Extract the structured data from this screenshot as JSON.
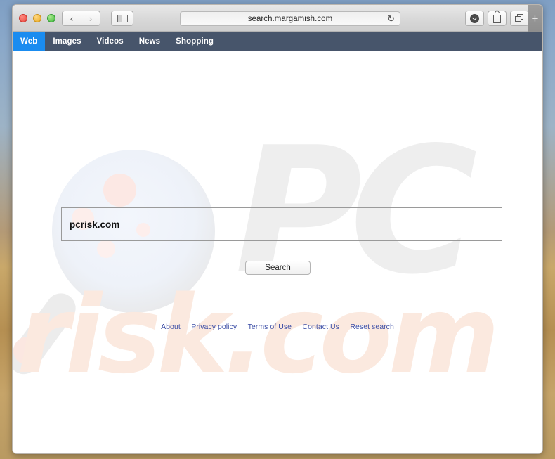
{
  "browser": {
    "window_controls": [
      "close",
      "minimize",
      "maximize"
    ],
    "nav_back_icon": "chevron-left-icon",
    "nav_back_glyph": "‹",
    "nav_forward_icon": "chevron-right-icon",
    "nav_forward_glyph": "›",
    "sidebar_icon": "sidebar-toggle-icon",
    "url": "search.margamish.com",
    "reload_glyph": "↻",
    "reload_icon": "reload-icon",
    "downloads_icon": "downloads-icon",
    "share_icon": "share-icon",
    "tabs_icon": "show-tabs-icon",
    "new_tab_label": "+"
  },
  "sitenav": {
    "items": [
      {
        "label": "Web",
        "active": true
      },
      {
        "label": "Images",
        "active": false
      },
      {
        "label": "Videos",
        "active": false
      },
      {
        "label": "News",
        "active": false
      },
      {
        "label": "Shopping",
        "active": false
      }
    ],
    "bar_color": "#47556b",
    "active_color": "#1a8cf0"
  },
  "search": {
    "value": "pcrisk.com",
    "placeholder": "",
    "button_label": "Search"
  },
  "footer": {
    "links": [
      "About",
      "Privacy policy",
      "Terms of Use",
      "Contact Us",
      "Reset search"
    ],
    "link_color": "#3c4ea6"
  },
  "watermark": {
    "logo_top": "PC",
    "logo_bottom": "risk.com",
    "gray": "#eeeeee",
    "orange": "#fbe9df"
  }
}
